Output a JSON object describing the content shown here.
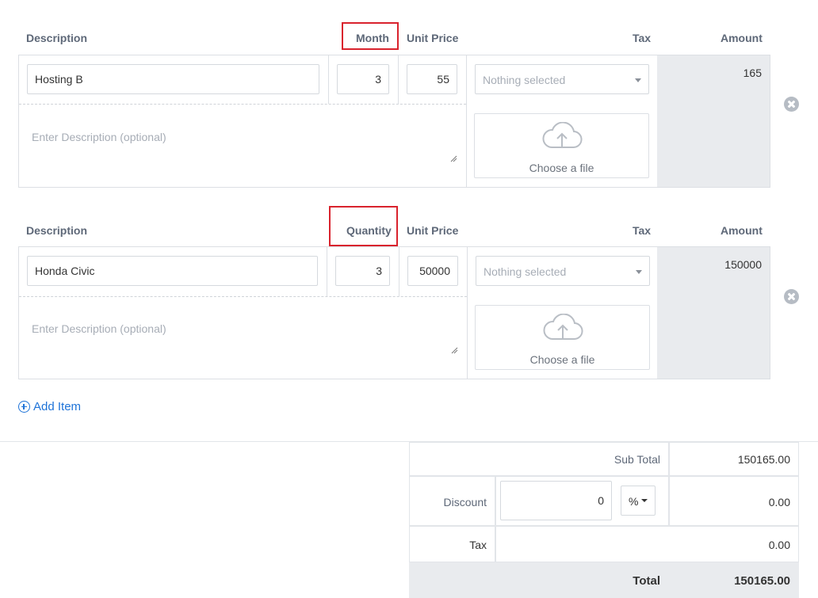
{
  "headers": {
    "description": "Description",
    "month": "Month",
    "quantity": "Quantity",
    "unit_price": "Unit Price",
    "tax": "Tax",
    "amount": "Amount"
  },
  "items": [
    {
      "name": "Hosting B",
      "qty": "3",
      "price": "55",
      "tax_placeholder": "Nothing selected",
      "desc_placeholder": "Enter Description (optional)",
      "upload_label": "Choose a file",
      "amount": "165"
    },
    {
      "name": "Honda Civic",
      "qty": "3",
      "price": "50000",
      "tax_placeholder": "Nothing selected",
      "desc_placeholder": "Enter Description (optional)",
      "upload_label": "Choose a file",
      "amount": "150000"
    }
  ],
  "add_item_label": "Add Item",
  "totals": {
    "subtotal_label": "Sub Total",
    "subtotal_value": "150165.00",
    "discount_label": "Discount",
    "discount_input": "0",
    "discount_type": "%",
    "discount_value": "0.00",
    "tax_label": "Tax",
    "tax_value": "0.00",
    "total_label": "Total",
    "total_value": "150165.00"
  },
  "icons": {
    "upload": "cloud-upload-icon",
    "remove": "remove-circle-icon",
    "add": "plus-circle-icon",
    "caret": "caret-down-icon"
  },
  "colors": {
    "link": "#1e73d8",
    "highlight_box": "#d9232d",
    "amount_bg": "#e9ebee"
  }
}
